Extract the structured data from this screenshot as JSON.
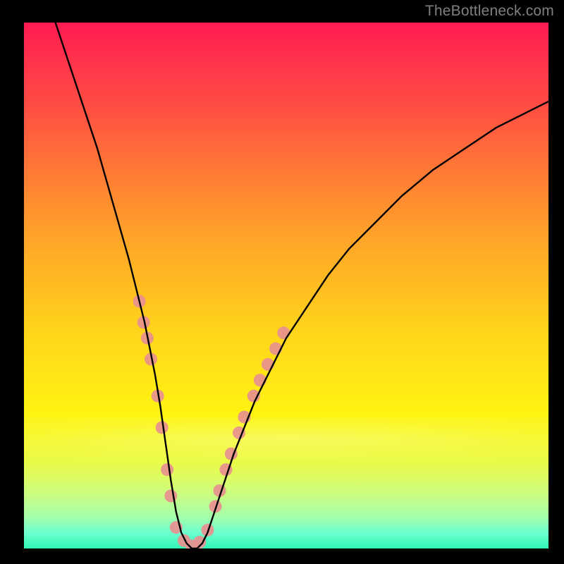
{
  "watermark": "TheBottleneck.com",
  "chart_data": {
    "type": "line",
    "title": "",
    "xlabel": "",
    "ylabel": "",
    "xlim": [
      0,
      100
    ],
    "ylim": [
      0,
      100
    ],
    "grid": false,
    "annotations": [],
    "series": [
      {
        "name": "curve",
        "color": "#000000",
        "x": [
          6,
          8,
          10,
          12,
          14,
          16,
          18,
          20,
          22,
          23,
          24,
          25,
          26,
          27,
          28,
          29,
          30,
          31,
          32,
          33,
          34,
          35,
          36,
          38,
          40,
          42,
          44,
          47,
          50,
          54,
          58,
          62,
          67,
          72,
          78,
          84,
          90,
          96,
          100
        ],
        "y": [
          100,
          94,
          88,
          82,
          76,
          69,
          62,
          55,
          47,
          43,
          38,
          33,
          27,
          20,
          13,
          7,
          3,
          1,
          0,
          0,
          1,
          3,
          6,
          12,
          18,
          23,
          28,
          34,
          40,
          46,
          52,
          57,
          62,
          67,
          72,
          76,
          80,
          83,
          85
        ]
      }
    ],
    "markers": [
      {
        "name": "dots-left",
        "color": "#e89090",
        "radius": 9,
        "points": [
          {
            "x": 22.0,
            "y": 47
          },
          {
            "x": 22.8,
            "y": 43
          },
          {
            "x": 23.5,
            "y": 40
          },
          {
            "x": 24.2,
            "y": 36
          },
          {
            "x": 25.5,
            "y": 29
          },
          {
            "x": 26.3,
            "y": 23
          },
          {
            "x": 27.3,
            "y": 15
          },
          {
            "x": 28.0,
            "y": 10
          }
        ]
      },
      {
        "name": "dots-bottom",
        "color": "#e89090",
        "radius": 9,
        "points": [
          {
            "x": 29.0,
            "y": 4
          },
          {
            "x": 30.5,
            "y": 1.5
          },
          {
            "x": 32.0,
            "y": 0.5
          },
          {
            "x": 33.5,
            "y": 1.2
          },
          {
            "x": 35.0,
            "y": 3.5
          }
        ]
      },
      {
        "name": "dots-right",
        "color": "#e89090",
        "radius": 9,
        "points": [
          {
            "x": 36.5,
            "y": 8
          },
          {
            "x": 37.3,
            "y": 11
          },
          {
            "x": 38.5,
            "y": 15
          },
          {
            "x": 39.5,
            "y": 18
          },
          {
            "x": 41.0,
            "y": 22
          },
          {
            "x": 42.0,
            "y": 25
          },
          {
            "x": 43.8,
            "y": 29
          },
          {
            "x": 45.0,
            "y": 32
          },
          {
            "x": 46.5,
            "y": 35
          },
          {
            "x": 48.0,
            "y": 38
          },
          {
            "x": 49.5,
            "y": 41
          }
        ]
      }
    ],
    "background_gradient": {
      "top": "#ff1a52",
      "mid": "#ffe716",
      "bottom": "#31f5b6"
    }
  }
}
